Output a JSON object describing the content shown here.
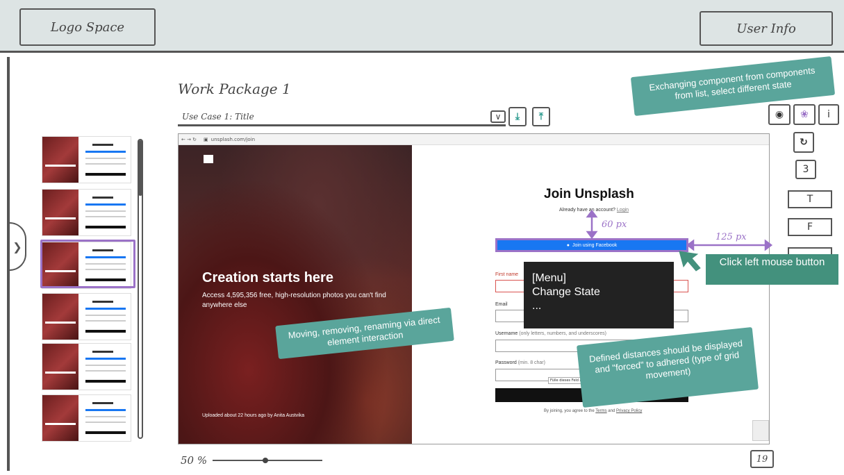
{
  "header": {
    "logo": "Logo Space",
    "user_info": "User Info"
  },
  "work_package": {
    "title": "Work Package 1"
  },
  "use_case": {
    "selected": "Use Case 1: Title"
  },
  "toolbar": {
    "download_icon": "download-icon",
    "upload_icon": "upload-icon",
    "comment_count": "3",
    "text_box": "T",
    "f_box": "F",
    "info_label": "i"
  },
  "browser": {
    "url": "unsplash.com/join"
  },
  "hero": {
    "title": "Creation starts here",
    "subtitle": "Access 4,595,356 free, high-resolution photos you can't find anywhere else",
    "credit": "Uploaded about 22 hours ago by Anita Austvika"
  },
  "form": {
    "title": "Join Unsplash",
    "already_text": "Already have an account?",
    "login_link": "Login",
    "facebook_button": "Join using Facebook",
    "first_name_label": "First name",
    "email_label": "Email",
    "username_label": "Username",
    "username_hint": "(only letters, numbers, and underscores)",
    "password_label": "Password",
    "password_hint": "(min. 8 char)",
    "tooltip": "Fülle dieses Feld aus.",
    "terms_prefix": "By joining, you agree to the",
    "terms_link": "Terms",
    "terms_and": "and",
    "privacy_link": "Privacy Policy"
  },
  "annotations": {
    "distance_vertical": "60 px",
    "distance_horizontal": "125 px",
    "click_note": "Click left mouse button",
    "note_exchange": "Exchanging component from components from list, select different state",
    "note_moving": "Moving, removing, renaming via direct element interaction",
    "note_distances": "Defined distances should be displayed and \"forced\" to adhered (type of grid movement)"
  },
  "context_menu": {
    "line1": "[Menu]",
    "line2": "Change State",
    "line3": "..."
  },
  "footer": {
    "zoom": "50 %",
    "zoom_level": 0.5,
    "page_count": "19"
  },
  "colors": {
    "accent_purple": "#9b72c7",
    "note_teal": "#5aa59b",
    "header_bg": "#dde4e4",
    "facebook_blue": "#1877f2"
  }
}
